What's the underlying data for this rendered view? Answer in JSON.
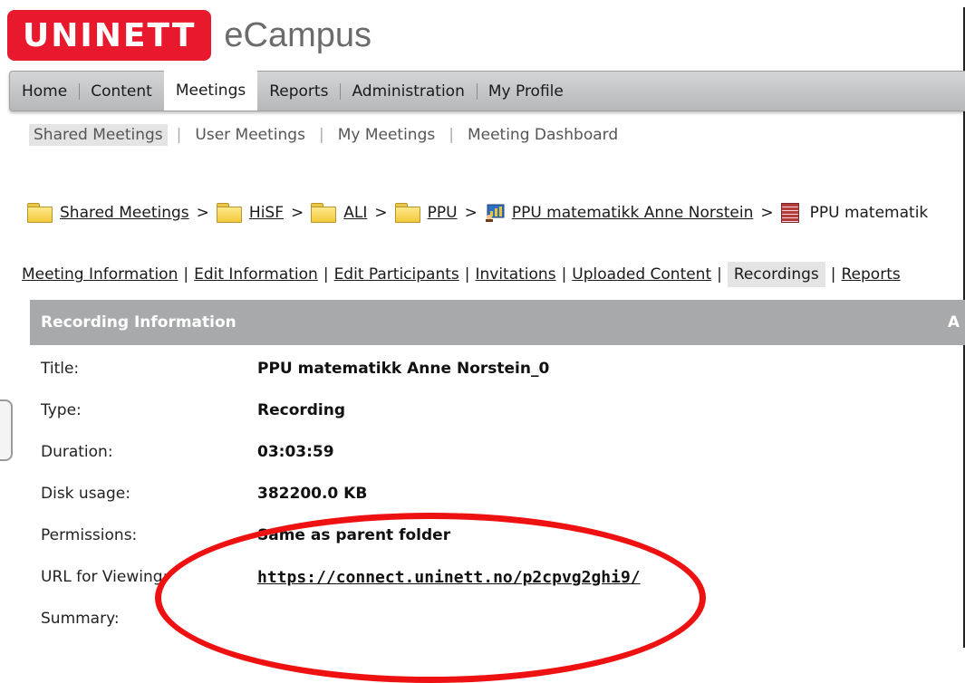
{
  "header": {
    "logo_brand": "UNINETT",
    "logo_product": "eCampus",
    "brand_color": "#e8192c"
  },
  "main_nav": {
    "items": [
      {
        "label": "Home"
      },
      {
        "label": "Content"
      },
      {
        "label": "Meetings",
        "active": true
      },
      {
        "label": "Reports"
      },
      {
        "label": "Administration"
      },
      {
        "label": "My Profile"
      }
    ]
  },
  "sub_nav": {
    "items": [
      {
        "label": "Shared Meetings",
        "active": true
      },
      {
        "label": "User Meetings"
      },
      {
        "label": "My Meetings"
      },
      {
        "label": "Meeting Dashboard"
      }
    ]
  },
  "breadcrumb": {
    "separator": ">",
    "items": [
      {
        "label": "Shared Meetings",
        "icon": "folder-icon"
      },
      {
        "label": "HiSF",
        "icon": "folder-icon"
      },
      {
        "label": "ALI",
        "icon": "folder-icon"
      },
      {
        "label": "PPU",
        "icon": "folder-icon"
      },
      {
        "label": "PPU matematikk Anne Norstein",
        "icon": "meeting-icon"
      },
      {
        "label": "PPU matematik",
        "icon": "recording-icon"
      }
    ]
  },
  "tabs": {
    "separator": "|",
    "items": [
      {
        "label": "Meeting Information"
      },
      {
        "label": "Edit Information"
      },
      {
        "label": "Edit Participants"
      },
      {
        "label": "Invitations"
      },
      {
        "label": "Uploaded Content"
      },
      {
        "label": "Recordings",
        "active": true
      },
      {
        "label": "Reports"
      }
    ]
  },
  "recording_info": {
    "header": "Recording Information",
    "header_corner": "A",
    "rows": [
      {
        "label": "Title:",
        "value": "PPU matematikk Anne Norstein_0"
      },
      {
        "label": "Type:",
        "value": "Recording"
      },
      {
        "label": "Duration:",
        "value": "03:03:59"
      },
      {
        "label": "Disk usage:",
        "value": "382200.0 KB"
      },
      {
        "label": "Permissions:",
        "value": "Same as parent folder"
      },
      {
        "label": "URL for Viewing:",
        "value": "https://connect.uninett.no/p2cpvg2ghi9/"
      },
      {
        "label": "Summary:",
        "value": ""
      }
    ]
  },
  "annotation_color": "#ee1111"
}
